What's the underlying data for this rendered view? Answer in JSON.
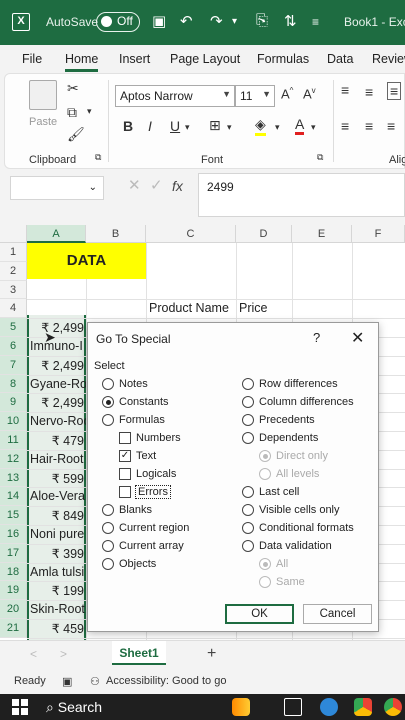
{
  "titlebar": {
    "autosave": "AutoSave",
    "toggle": "Off",
    "book": "Book1 - Exc"
  },
  "menu": [
    "File",
    "Home",
    "Insert",
    "Page Layout",
    "Formulas",
    "Data",
    "Review"
  ],
  "ribbon": {
    "paste": "Paste",
    "clipboard": "Clipboard",
    "font_name": "Aptos Narrow",
    "font_size": "11",
    "font_group": "Font",
    "align_group": "Alig",
    "bold": "B",
    "italic": "I",
    "underline": "U"
  },
  "formula": {
    "fx": "fx",
    "value": "2499"
  },
  "grid": {
    "columns": [
      "A",
      "B",
      "C",
      "D",
      "E",
      "F"
    ],
    "rows": [
      "1",
      "2",
      "3",
      "4",
      "5",
      "6",
      "7",
      "8",
      "9",
      "10",
      "11",
      "12",
      "13",
      "14",
      "15",
      "16",
      "17",
      "18",
      "19",
      "20",
      "21"
    ],
    "data_label": "DATA",
    "headers": {
      "product": "Product Name",
      "price": "Price"
    },
    "colA": [
      "₹ 2,499",
      "Immuno-I",
      "₹ 2,499",
      "Gyane-Ro",
      "₹ 2,499",
      "Nervo-Roo",
      "₹ 479",
      "Hair-Root",
      "₹ 599",
      "Aloe-Vera",
      "₹ 849",
      "Noni pure",
      "₹ 399",
      "Amla tulsi",
      "₹ 199",
      "Skin-Root",
      "₹ 459"
    ]
  },
  "dialog": {
    "title": "Go To Special",
    "help": "?",
    "close": "✕",
    "select": "Select",
    "left_options": [
      {
        "label": "Notes",
        "checked": false
      },
      {
        "label": "Constants",
        "checked": true
      },
      {
        "label": "Formulas",
        "checked": false
      }
    ],
    "sub_checks": [
      {
        "label": "Numbers",
        "checked": false
      },
      {
        "label": "Text",
        "checked": true
      },
      {
        "label": "Logicals",
        "checked": false
      },
      {
        "label": "Errors",
        "checked": false
      }
    ],
    "left_options2": [
      "Blanks",
      "Current region",
      "Current array",
      "Objects"
    ],
    "right_options": [
      "Row differences",
      "Column differences",
      "Precedents",
      "Dependents"
    ],
    "dep_sub": [
      "Direct only",
      "All levels"
    ],
    "right_options2": [
      "Last cell",
      "Visible cells only",
      "Conditional formats",
      "Data validation"
    ],
    "val_sub": [
      "All",
      "Same"
    ],
    "ok": "OK",
    "cancel": "Cancel"
  },
  "sheet": {
    "tab": "Sheet1",
    "add": "+"
  },
  "status": {
    "ready": "Ready",
    "accessibility": "Accessibility: Good to go"
  },
  "taskbar": {
    "search": "Search"
  },
  "colors": {
    "excel_green": "#1e6c41",
    "highlight": "#ffff00"
  }
}
